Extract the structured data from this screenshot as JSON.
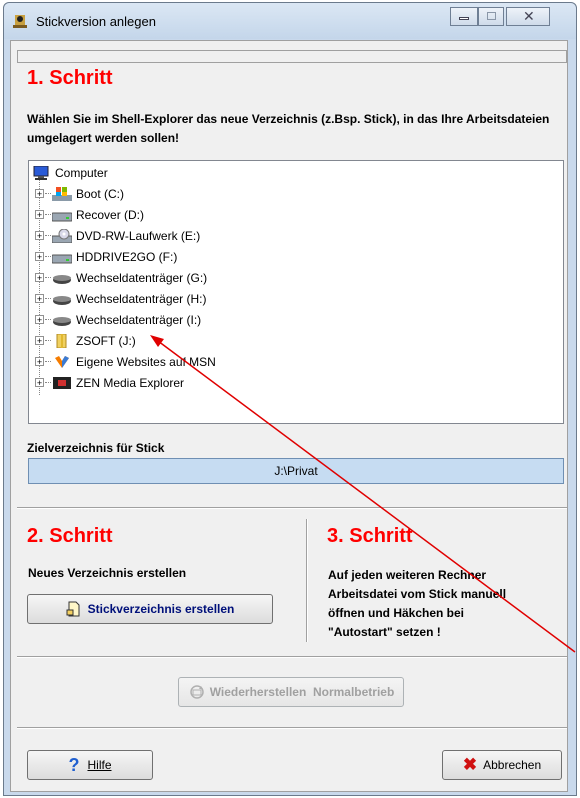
{
  "window": {
    "title": "Stickversion anlegen"
  },
  "step1": {
    "title": "1. Schritt",
    "instruction": "Wählen Sie im Shell-Explorer das neue Verzeichnis (z.Bsp. Stick), in das Ihre Arbeitsdateien umgelagert werden sollen!"
  },
  "tree": {
    "root": "Computer",
    "items": [
      {
        "label": "Boot (C:)",
        "icon": "windows-drive-icon"
      },
      {
        "label": "Recover (D:)",
        "icon": "hard-drive-icon"
      },
      {
        "label": "DVD-RW-Laufwerk (E:)",
        "icon": "dvd-drive-icon"
      },
      {
        "label": "HDDRIVE2GO (F:)",
        "icon": "hard-drive-icon"
      },
      {
        "label": "Wechseldatenträger (G:)",
        "icon": "removable-drive-icon"
      },
      {
        "label": "Wechseldatenträger (H:)",
        "icon": "removable-drive-icon"
      },
      {
        "label": "Wechseldatenträger (I:)",
        "icon": "removable-drive-icon"
      },
      {
        "label": "ZSOFT (J:)",
        "icon": "usb-folder-icon"
      },
      {
        "label": "Eigene Websites auf MSN",
        "icon": "msn-icon"
      },
      {
        "label": "ZEN Media Explorer",
        "icon": "zen-media-icon"
      }
    ]
  },
  "target": {
    "label": "Zielverzeichnis für Stick",
    "value": "J:\\Privat"
  },
  "step2": {
    "title": "2. Schritt",
    "text": "Neues Verzeichnis erstellen",
    "button": "Stickverzeichnis erstellen"
  },
  "step3": {
    "title": "3. Schritt",
    "text_lines": [
      "Auf jeden weiteren Rechner",
      "Arbeitsdatei vom Stick manuell",
      "öffnen und Häkchen bei",
      "\"Autostart\" setzen !"
    ]
  },
  "restore_button": "Wiederherstellen  Normalbetrieb",
  "help_button": "Hilfe",
  "cancel_button": "Abbrechen",
  "colors": {
    "step_title": "#ff0000",
    "annotation_arrow": "#e00000",
    "target_box": "#c6dcf2"
  }
}
